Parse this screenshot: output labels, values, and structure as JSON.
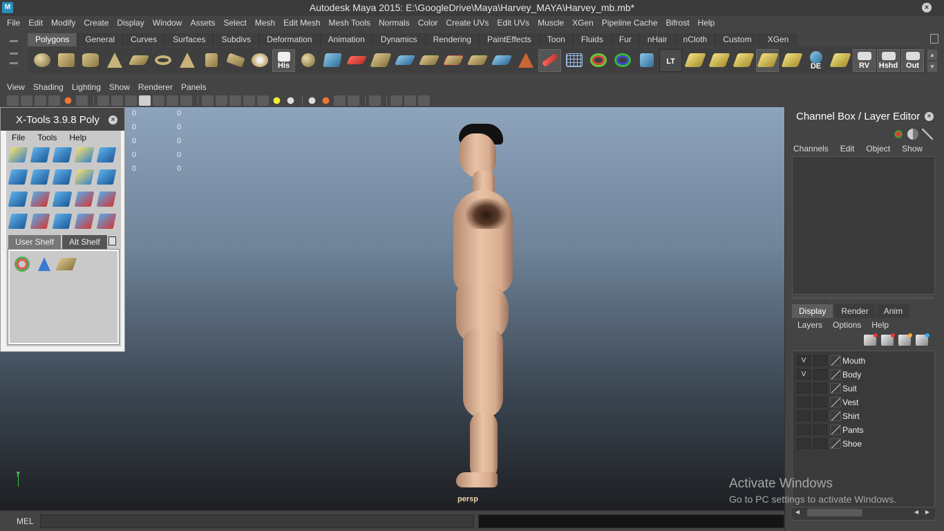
{
  "window": {
    "title": "Autodesk Maya 2015: E:\\GoogleDrive\\Maya\\Harvey_MAYA\\Harvey_mb.mb*"
  },
  "menubar": [
    "File",
    "Edit",
    "Modify",
    "Create",
    "Display",
    "Window",
    "Assets",
    "Select",
    "Mesh",
    "Edit Mesh",
    "Mesh Tools",
    "Normals",
    "Color",
    "Create UVs",
    "Edit UVs",
    "Muscle",
    "XGen",
    "Pipeline Cache",
    "Bifrost",
    "Help"
  ],
  "shelf": {
    "tabs": [
      "Polygons",
      "General",
      "Curves",
      "Surfaces",
      "Subdivs",
      "Deformation",
      "Animation",
      "Dynamics",
      "Rendering",
      "PaintEffects",
      "Toon",
      "Fluids",
      "Fur",
      "nHair",
      "nCloth",
      "Custom",
      "XGen"
    ],
    "active_tab": "Polygons",
    "his_label": "His",
    "lt_label": "LT",
    "de_label": "DE",
    "rv_label": "RV",
    "hshd_label": "Hshd",
    "out_label": "Out"
  },
  "panel_menu": [
    "View",
    "Shading",
    "Lighting",
    "Show",
    "Renderer",
    "Panels"
  ],
  "viewport": {
    "hud_values": [
      "0",
      "0",
      "0",
      "0",
      "0"
    ],
    "camera_label": "persp",
    "axis_label": "y",
    "skin_color": "#e0b898"
  },
  "xtools": {
    "title": "X-Tools 3.9.8 Poly",
    "menu": [
      "File",
      "Tools",
      "Help"
    ],
    "tabs": [
      "User Shelf",
      "Alt Shelf"
    ],
    "active_tab": "User Shelf"
  },
  "channel_box": {
    "title": "Channel Box / Layer Editor",
    "menu": [
      "Channels",
      "Edit",
      "Object",
      "Show"
    ],
    "layer_tabs": [
      "Display",
      "Render",
      "Anim"
    ],
    "active_layer_tab": "Display",
    "layer_menu": [
      "Layers",
      "Options",
      "Help"
    ],
    "layers": [
      {
        "name": "Mouth",
        "visible": "V"
      },
      {
        "name": "Body",
        "visible": "V"
      },
      {
        "name": "Suit",
        "visible": ""
      },
      {
        "name": "Vest",
        "visible": ""
      },
      {
        "name": "Shirt",
        "visible": ""
      },
      {
        "name": "Pants",
        "visible": ""
      },
      {
        "name": "Shoe",
        "visible": ""
      }
    ]
  },
  "watermark": {
    "line1": "Activate Windows",
    "line2": "Go to PC settings to activate Windows."
  },
  "command_line": {
    "label": "MEL",
    "value": ""
  }
}
